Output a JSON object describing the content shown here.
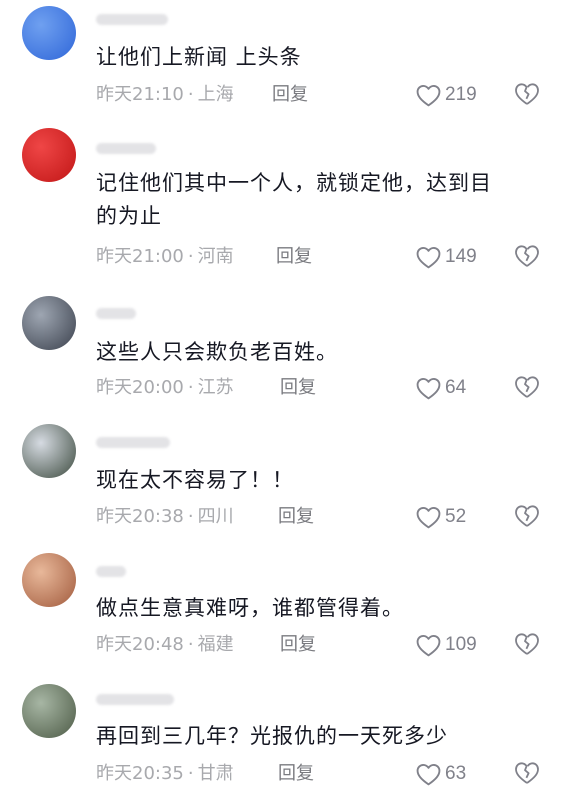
{
  "comments": [
    {
      "text": "让他们上新闻 上头条",
      "time": "昨天21:10",
      "location": "上海",
      "reply_label": "回复",
      "likes": "219",
      "avatar_colors": [
        "#6fa0f0",
        "#2f66d8"
      ]
    },
    {
      "text": "记住他们其中一个人，就锁定他，达到目的为止",
      "time": "昨天21:00",
      "location": "河南",
      "reply_label": "回复",
      "likes": "149",
      "avatar_colors": [
        "#ef4646",
        "#c11616"
      ]
    },
    {
      "text": "这些人只会欺负老百姓。",
      "time": "昨天20:00",
      "location": "江苏",
      "reply_label": "回复",
      "likes": "64",
      "avatar_colors": [
        "#9ea6b2",
        "#3a404c"
      ]
    },
    {
      "text": "现在太不容易了！！",
      "time": "昨天20:38",
      "location": "四川",
      "reply_label": "回复",
      "likes": "52",
      "avatar_colors": [
        "#d6dbe2",
        "#3c4a3e"
      ]
    },
    {
      "text": "做点生意真难呀，谁都管得着。",
      "time": "昨天20:48",
      "location": "福建",
      "reply_label": "回复",
      "likes": "109",
      "avatar_colors": [
        "#e8b89a",
        "#a15a3c"
      ]
    },
    {
      "text": "再回到三几年？光报仇的一天死多少",
      "time": "昨天20:35",
      "location": "甘肃",
      "reply_label": "回复",
      "likes": "63",
      "avatar_colors": [
        "#a7b6a4",
        "#4c5a45"
      ]
    }
  ],
  "meta_separator": "·",
  "icons": {
    "like": "heart-outline-icon",
    "dislike": "broken-heart-icon"
  },
  "colors": {
    "text": "#161823",
    "meta": "#a8a9ad",
    "reply": "#7a7b80",
    "icon": "#80818a"
  }
}
